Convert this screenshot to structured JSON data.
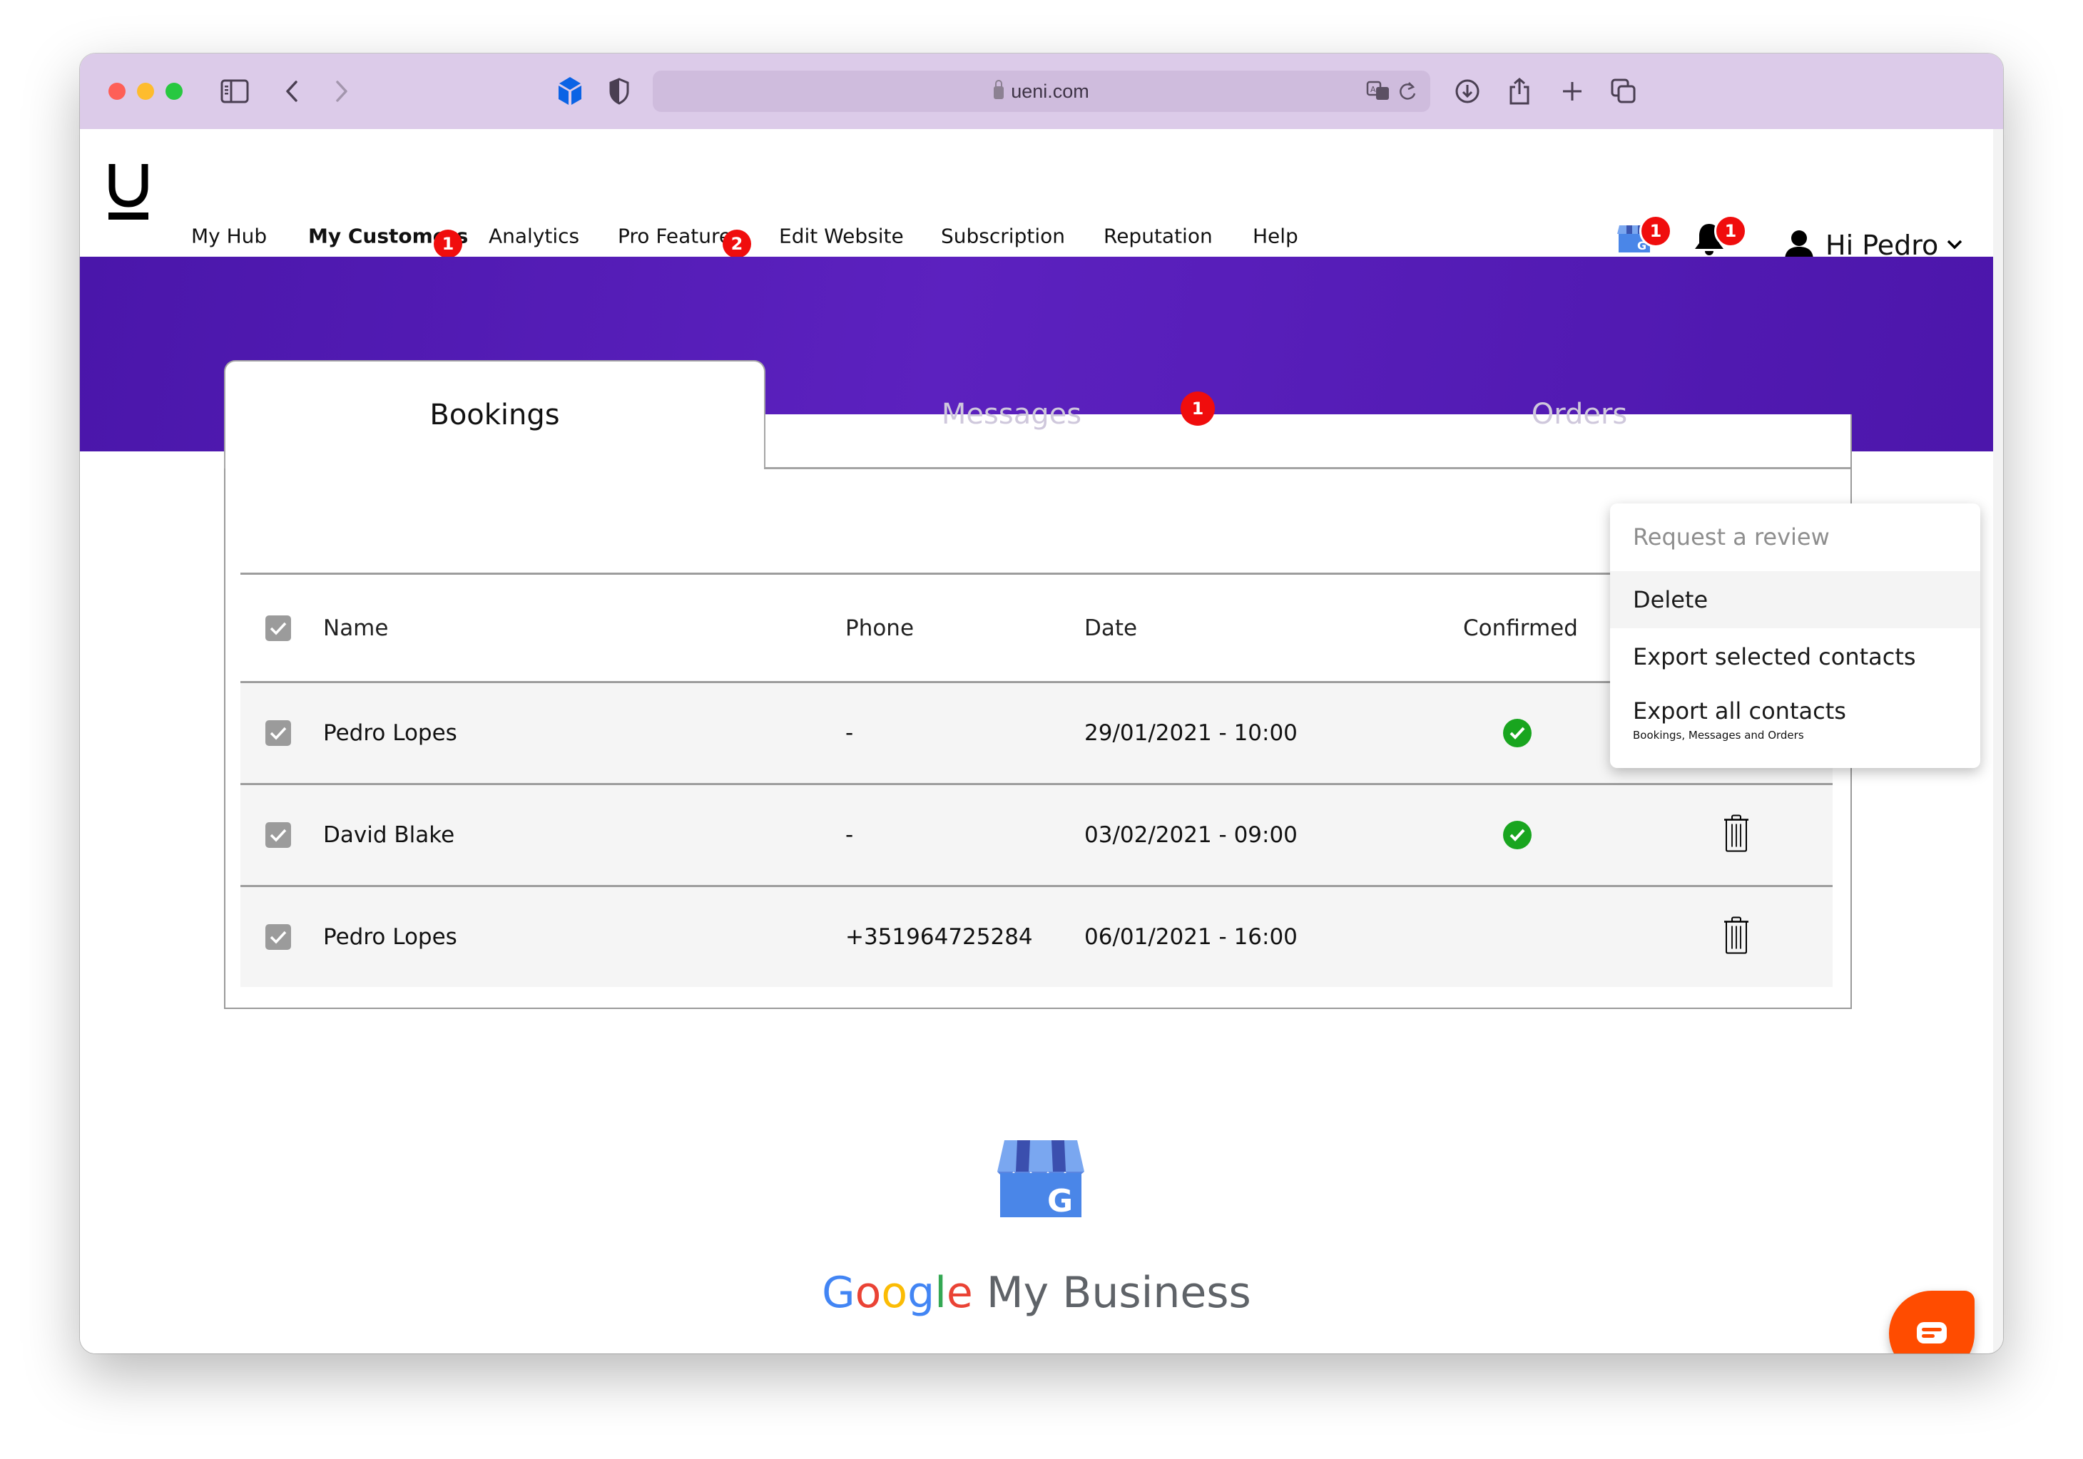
{
  "browser": {
    "url": "ueni.com",
    "icons": [
      "sidebar-icon",
      "back-icon",
      "forward-icon",
      "extension-cube-icon",
      "privacy-shield-icon",
      "translate-icon",
      "reload-icon",
      "download-icon",
      "share-icon",
      "new-tab-icon",
      "tabs-overview-icon"
    ]
  },
  "nav": {
    "logo": "U",
    "items": [
      {
        "label": "My Hub",
        "active": false
      },
      {
        "label": "My Customers",
        "active": true,
        "badge": "1"
      },
      {
        "label": "Analytics",
        "active": false
      },
      {
        "label": "Pro Features",
        "active": false,
        "badge": "2"
      },
      {
        "label": "Edit Website",
        "active": false
      },
      {
        "label": "Subscription",
        "active": false
      },
      {
        "label": "Reputation",
        "active": false
      },
      {
        "label": "Help",
        "active": false
      }
    ],
    "gmb_badge": "1",
    "notifications_badge": "1",
    "user_greeting": "Hi Pedro"
  },
  "tabs": [
    {
      "label": "Bookings",
      "active": true
    },
    {
      "label": "Messages",
      "active": false,
      "badge": "1"
    },
    {
      "label": "Orders",
      "active": false
    }
  ],
  "table": {
    "headers": {
      "name": "Name",
      "phone": "Phone",
      "date": "Date",
      "confirmed": "Confirmed"
    },
    "rows": [
      {
        "name": "Pedro Lopes",
        "phone": "-",
        "date": "29/01/2021 - 10:00",
        "confirmed": true,
        "selected": true
      },
      {
        "name": "David Blake",
        "phone": "-",
        "date": "03/02/2021 - 09:00",
        "confirmed": true,
        "selected": true
      },
      {
        "name": "Pedro Lopes",
        "phone": "+351964725284",
        "date": "06/01/2021 - 16:00",
        "confirmed": false,
        "selected": true
      }
    ]
  },
  "dropdown": {
    "items": [
      {
        "label": "Request a review",
        "disabled": true
      },
      {
        "label": "Delete",
        "hovered": true
      },
      {
        "label": "Export selected contacts"
      },
      {
        "label": "Export all contacts",
        "sublabel": "Bookings, Messages and Orders"
      }
    ]
  },
  "gmb": {
    "google_letters": [
      "G",
      "o",
      "o",
      "g",
      "l",
      "e"
    ],
    "suffix": "My Business"
  },
  "colors": {
    "brand_purple": "#5a1fbd",
    "badge_red": "#f00d0d",
    "confirmed_green": "#19a51f",
    "chat_orange": "#ff4c00"
  }
}
